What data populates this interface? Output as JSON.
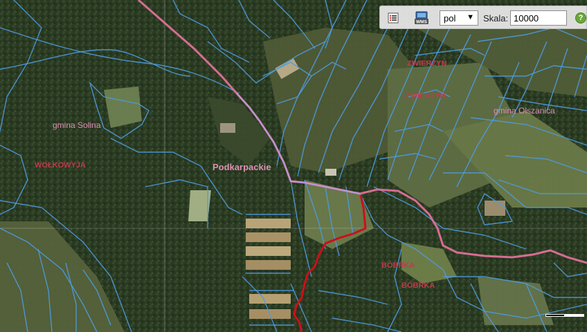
{
  "toolbar": {
    "list_icon": "list-icon",
    "wms_icon_label": "WMS",
    "language_value": "pol",
    "language_arrow": "▼",
    "scale_label": "Skala:",
    "scale_value": "10000",
    "help_label": "?"
  },
  "map_labels": {
    "gmina_solina": "gmina Solina",
    "wolkowyja": "WOŁKOWYJA",
    "podkarpackie": "Podkarpackie",
    "zwierzyn_a": "ZWIERZYŃ",
    "zwierzyn_b": "ZWIERZYŃ",
    "gmina_olszanica": "gmina Olszanica",
    "bobrka_a": "BÓBRKA",
    "bobrka_b": "BÓBRKA"
  },
  "colors": {
    "boundary_pink": "#e0709a",
    "boundary_red": "#cc0f1c",
    "parcel_blue": "#4d9be0",
    "label_pink": "#dd8fb4",
    "label_red": "#c23a4a"
  }
}
